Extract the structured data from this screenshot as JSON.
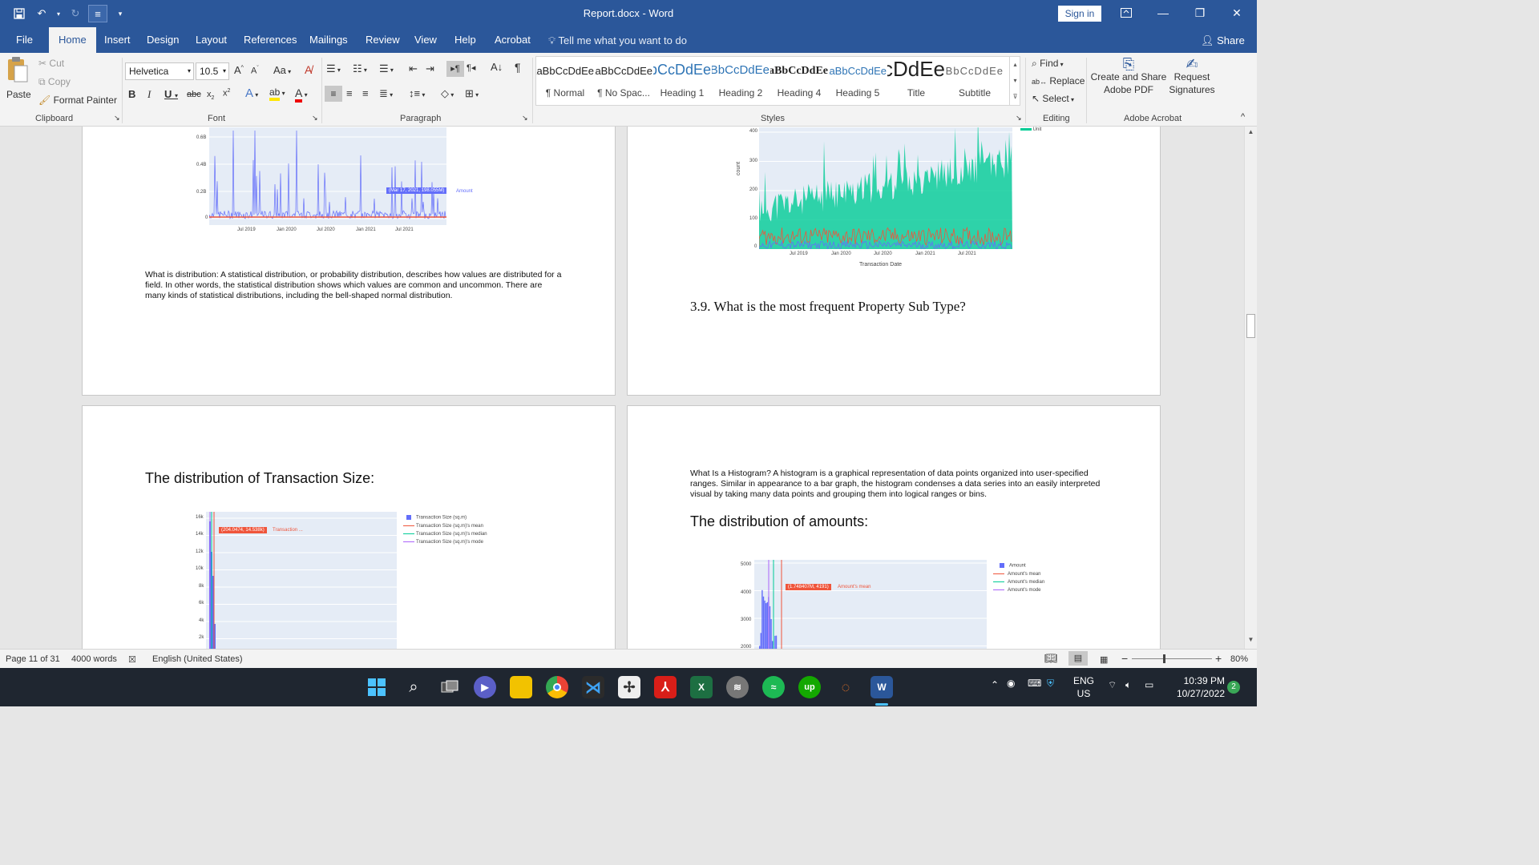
{
  "title_bar": {
    "title": "Report.docx - Word",
    "sign_in": "Sign in"
  },
  "tabs": [
    "File",
    "Home",
    "Insert",
    "Design",
    "Layout",
    "References",
    "Mailings",
    "Review",
    "View",
    "Help",
    "Acrobat"
  ],
  "active_tab": "Home",
  "tell_me": "Tell me what you want to do",
  "share": "Share",
  "ribbon": {
    "clipboard": {
      "paste": "Paste",
      "cut": "Cut",
      "copy": "Copy",
      "format_painter": "Format Painter",
      "label": "Clipboard"
    },
    "font": {
      "name": "Helvetica",
      "size": "10.5",
      "label": "Font",
      "change_case": "Aa"
    },
    "paragraph": {
      "label": "Paragraph"
    },
    "styles": {
      "label": "Styles",
      "items": [
        {
          "sample": "AaBbCcDdEe",
          "name": "¶ Normal"
        },
        {
          "sample": "AaBbCcDdEe",
          "name": "¶ No Spac..."
        },
        {
          "sample": "AaBbCcDdEe",
          "name": "Heading 1"
        },
        {
          "sample": "AaBbCcDdEe",
          "name": "Heading 2"
        },
        {
          "sample": "AaBbCcDdEe",
          "name": "Heading 4"
        },
        {
          "sample": "AaBbCcDdEe",
          "name": "Heading 5"
        },
        {
          "sample": "AaBbCcDdEe",
          "name": "Title"
        },
        {
          "sample": "AaBbCcDdEe",
          "name": "Subtitle"
        }
      ]
    },
    "editing": {
      "find": "Find",
      "replace": "Replace",
      "select": "Select",
      "label": "Editing"
    },
    "acrobat": {
      "create_share": "Create and Share Adobe PDF",
      "request_sig": "Request Signatures",
      "label": "Adobe Acrobat"
    }
  },
  "pages": {
    "top_left": {
      "chart": {
        "y_ticks": [
          "0.6B",
          "0.4B",
          "0.2B",
          "0"
        ],
        "x_ticks": [
          "Jul 2019",
          "Jan 2020",
          "Jul 2020",
          "Jan 2021",
          "Jul 2021"
        ],
        "hover": "(Mar 17, 2021, 198.055M)",
        "hover_series": "Amount"
      },
      "paragraph": "What is distribution: A statistical distribution, or probability distribution, describes how values are distributed for a field. In other words, the statistical distribution shows which values are common and uncommon. There are many kinds of statistical distributions, including the bell-shaped normal distribution."
    },
    "top_right": {
      "chart": {
        "y_ticks": [
          "400",
          "300",
          "200",
          "100",
          "0"
        ],
        "x_ticks": [
          "Jul 2019",
          "Jan 2020",
          "Jul 2020",
          "Jan 2021",
          "Jul 2021"
        ],
        "ylabel": "count",
        "xlabel": "Transaction Date",
        "legend": "Unit"
      },
      "heading": "3.9. What is the most frequent Property Sub Type?"
    },
    "bottom_left": {
      "heading": "The distribution of Transaction Size:",
      "chart": {
        "y_ticks": [
          "16k",
          "14k",
          "12k",
          "10k",
          "8k",
          "6k",
          "4k",
          "2k"
        ],
        "hover": "(204.0474, 14.538k)",
        "hover_series": "Transaction ...",
        "legend": [
          {
            "label": "Transaction Size (sq.m)",
            "color": "#636efa"
          },
          {
            "label": "Transaction Size (sq.m)'s mean",
            "color": "#ef553b"
          },
          {
            "label": "Transaction Size (sq.m)'s median",
            "color": "#00cc96"
          },
          {
            "label": "Transaction Size (sq.m)'s mode",
            "color": "#ab63fa"
          }
        ]
      }
    },
    "bottom_right": {
      "paragraph": "What Is a Histogram? A histogram is a graphical representation of data points organized into user-specified ranges. Similar in appearance to a bar graph, the histogram condenses a data series into an easily interpreted visual by taking many data points and grouping them into logical ranges or bins.",
      "heading": "The distribution of amounts:",
      "chart": {
        "y_ticks": [
          "5000",
          "4000",
          "3000",
          "2000"
        ],
        "hover": "(1.748407M, 4191)",
        "hover_series": "Amount's mean",
        "legend": [
          {
            "label": "Amount",
            "color": "#636efa"
          },
          {
            "label": "Amount's mean",
            "color": "#ef553b"
          },
          {
            "label": "Amount's median",
            "color": "#00cc96"
          },
          {
            "label": "Amount's mode",
            "color": "#ab63fa"
          }
        ]
      }
    }
  },
  "status_bar": {
    "page": "Page 11 of 31",
    "words": "4000 words",
    "language": "English (United States)",
    "zoom": "80%"
  },
  "taskbar": {
    "lang": "ENG",
    "region": "US",
    "time": "10:39 PM",
    "date": "10/27/2022",
    "notifications": "2"
  }
}
